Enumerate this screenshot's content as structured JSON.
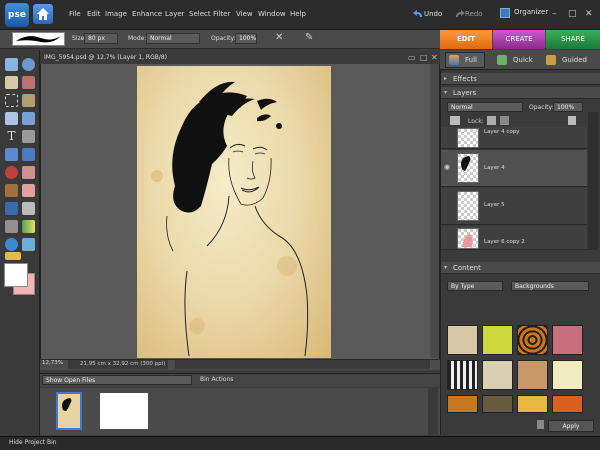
{
  "app": {
    "logo_text": "pse"
  },
  "menu": [
    "File",
    "Edit",
    "Image",
    "Enhance",
    "Layer",
    "Select",
    "Filter",
    "View",
    "Window",
    "Help"
  ],
  "history": {
    "undo": "Undo",
    "redo": "Redo"
  },
  "organizer": "Organizer",
  "window_controls": {
    "minimize": "–",
    "maximize": "□",
    "close": "✕"
  },
  "options": {
    "size_label": "Size:",
    "size_value": "80 px",
    "mode_label": "Mode:",
    "mode_value": "Normal",
    "opacity_label": "Opacity:",
    "opacity_value": "100%"
  },
  "tabs": {
    "edit": "EDIT",
    "create": "CREATE",
    "share": "SHARE"
  },
  "edit_modes": [
    "Full",
    "Quick",
    "Guided"
  ],
  "document": {
    "title": "IMG_5954.psd @ 12,7% (Layer 1, RGB/8)",
    "zoom": "12,73%",
    "info": "21,95 cm x 32,92 cm (300 ppi)"
  },
  "bin": {
    "select": "Show Open Files",
    "actions": "Bin Actions"
  },
  "panels": {
    "effects": "Effects",
    "layers": "Layers",
    "blend_mode": "Normal",
    "opacity_label": "Opacity:",
    "opacity_value": "100%",
    "lock_label": "Lock:",
    "layer_items": [
      {
        "name": "Layer 4 copy"
      },
      {
        "name": "Layer 4"
      },
      {
        "name": "Layer 5"
      },
      {
        "name": "Layer 6 copy 2"
      }
    ],
    "content": "Content",
    "content_filter": "By Type",
    "content_category": "Backgrounds",
    "apply": "Apply"
  },
  "footer": {
    "hide_bin": "Hide Project Bin"
  },
  "colors": {
    "edit_tab": "#f08020",
    "create_tab": "#b040b0",
    "share_tab": "#2a9a4a",
    "background_swatch": "#f4b4b4"
  }
}
